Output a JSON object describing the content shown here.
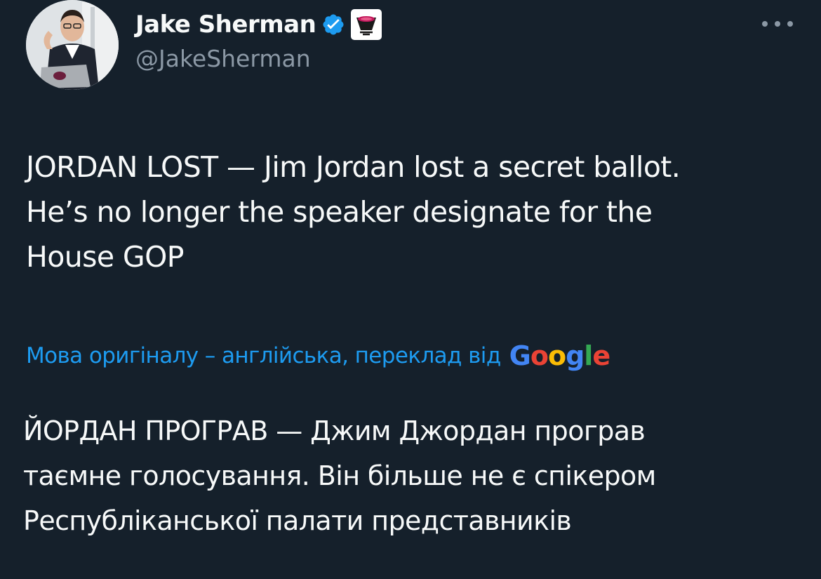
{
  "author": {
    "display_name": "Jake Sherman",
    "handle": "@JakeSherman"
  },
  "icons": {
    "verified": "verified-badge-icon",
    "affiliation": "affiliation-badge-icon",
    "more": "more-options-icon"
  },
  "tweet": {
    "lines": [
      "JORDAN LOST — Jim Jordan lost a secret ballot.",
      "He’s no longer the speaker designate for the",
      "House GOP"
    ]
  },
  "translation": {
    "note": "Мова оригіналу – англійська, переклад від",
    "provider": {
      "letters": [
        "G",
        "o",
        "o",
        "g",
        "l",
        "e"
      ],
      "colors": [
        "#4285f4",
        "#ea4335",
        "#fbbc05",
        "#4285f4",
        "#34a853",
        "#ea4335"
      ]
    },
    "lines": [
      "ЙОРДАН ПРОГРАВ — Джим Джордан програв",
      "таємне голосування. Він більше не є спікером",
      "Республіканської палати представників"
    ]
  },
  "colors": {
    "background": "#15202b",
    "text": "#f7f9f9",
    "secondary": "#8b98a5",
    "accent": "#1d9bf0"
  }
}
